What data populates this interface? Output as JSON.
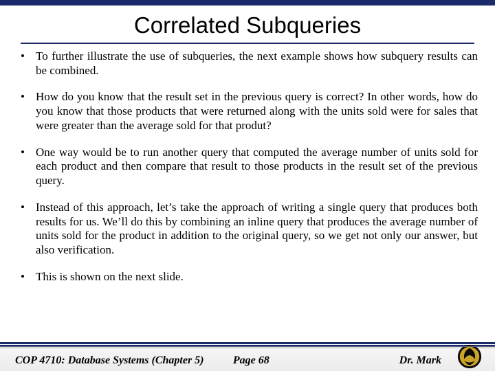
{
  "title": "Correlated Subqueries",
  "bullets": [
    "To further illustrate the use of subqueries, the next example shows how subquery results can be combined.",
    "How do you know that the result set in the previous query is correct?  In other words, how do you know that those products that were returned along with the units sold were for sales that were greater than the average sold for that produt?",
    "One way would be to run another query that computed the average number of units sold for each product and then compare that result to those products in the result set of the previous query.",
    "Instead of this approach, let’s take the approach of writing a single query that produces both results for us.  We’ll do this by combining an inline query that produces the average number of units sold for the product in addition to the original query, so we get not only our answer, but also verification.",
    "This is shown on the next slide."
  ],
  "footer": {
    "left": "COP 4710: Database Systems  (Chapter 5)",
    "center": "Page 68",
    "right": "Dr. Mark"
  }
}
